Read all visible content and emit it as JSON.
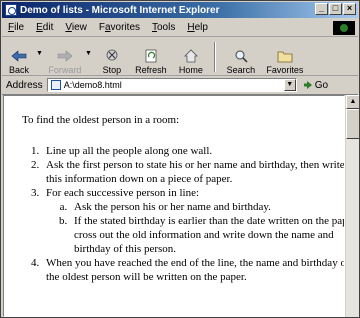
{
  "window": {
    "title": "Demo of lists - Microsoft Internet Explorer",
    "controls": [
      "_",
      "□",
      "×"
    ]
  },
  "menu": [
    {
      "label": "File",
      "key": "F",
      "rest": "ile"
    },
    {
      "label": "Edit",
      "key": "E",
      "rest": "dit"
    },
    {
      "label": "View",
      "key": "V",
      "rest": "iew"
    },
    {
      "label": "Favorites",
      "key": "a",
      "pre": "F",
      "rest": "vorites"
    },
    {
      "label": "Tools",
      "key": "T",
      "rest": "ools"
    },
    {
      "label": "Help",
      "key": "H",
      "rest": "elp"
    }
  ],
  "toolbar": {
    "back": "Back",
    "forward": "Forward",
    "stop": "Stop",
    "refresh": "Refresh",
    "home": "Home",
    "search": "Search",
    "favorites": "Favorites"
  },
  "address": {
    "label": "Address",
    "value": "A:\\demo8.html",
    "go": "Go"
  },
  "page": {
    "intro": "To find the oldest person in a room:",
    "step1": "Line up all the people along one wall.",
    "step2": "Ask the first person to state his or her name and birthday, then write this information down on a piece of paper.",
    "step3": "For each successive person in line:",
    "step3a": "Ask the person his or her name and birthday.",
    "step3b": "If the stated birthday is earlier than the date written on the paper, cross out the old information and write down the name and birthday of this person.",
    "step4": "When you have reached the end of the line, the name and birthday of the oldest person will be written on the paper."
  }
}
